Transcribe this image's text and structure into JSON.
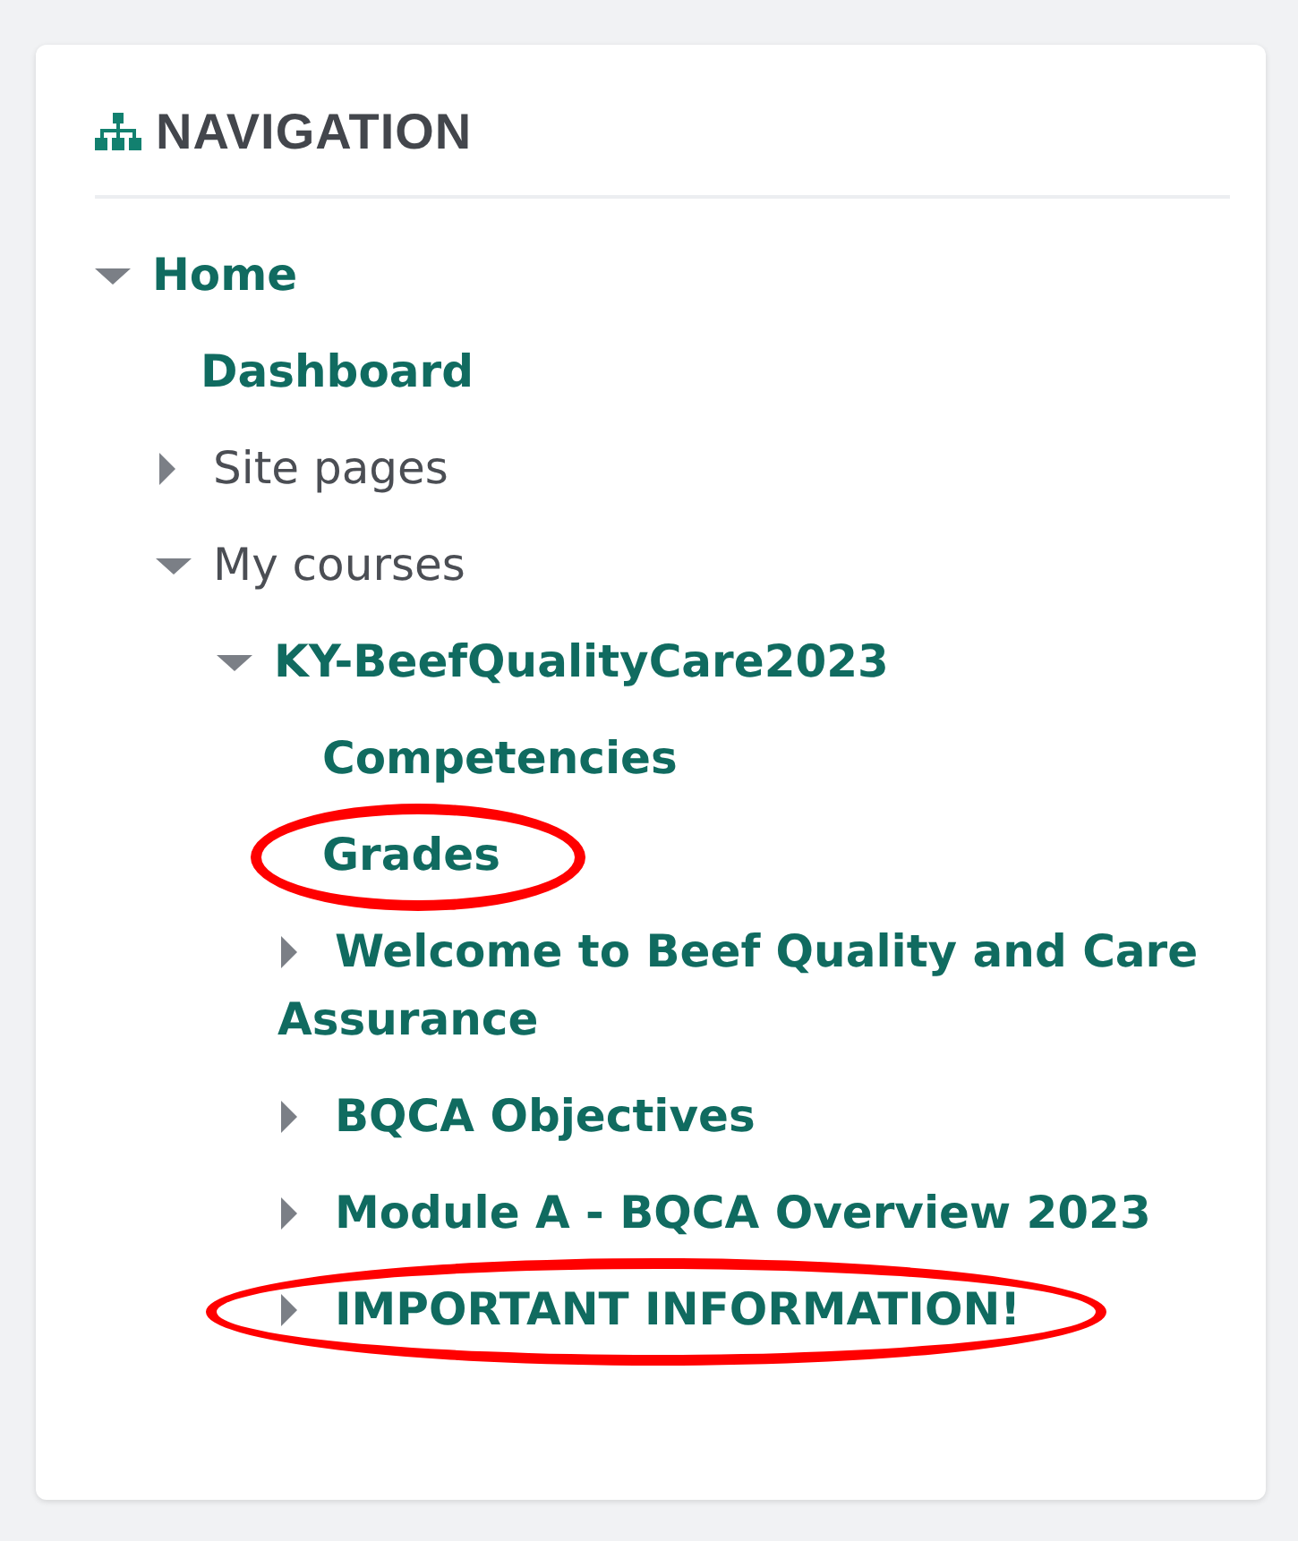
{
  "block": {
    "title": "NAVIGATION"
  },
  "tree": [
    {
      "label": "Home",
      "kind": "link",
      "expanded": true,
      "highlighted": false,
      "children": [
        {
          "label": "Dashboard",
          "kind": "link",
          "highlighted": false
        },
        {
          "label": "Site pages",
          "kind": "plain",
          "expanded": false,
          "highlighted": false
        },
        {
          "label": "My courses",
          "kind": "plain",
          "expanded": true,
          "highlighted": false,
          "children": [
            {
              "label": "KY-BeefQualityCare2023",
              "kind": "link",
              "expanded": true,
              "highlighted": false,
              "children": [
                {
                  "label": "Competencies",
                  "kind": "link",
                  "highlighted": false
                },
                {
                  "label": "Grades",
                  "kind": "link",
                  "highlighted": true
                },
                {
                  "label": "Welcome to Beef Quality and Care Assurance",
                  "kind": "link",
                  "expanded": false,
                  "highlighted": false
                },
                {
                  "label": "BQCA Objectives",
                  "kind": "link",
                  "expanded": false,
                  "highlighted": false
                },
                {
                  "label": "Module A - BQCA Overview 2023",
                  "kind": "link",
                  "expanded": false,
                  "highlighted": false
                },
                {
                  "label": "IMPORTANT INFORMATION!",
                  "kind": "link",
                  "expanded": false,
                  "highlighted": true
                }
              ]
            }
          ]
        }
      ]
    }
  ]
}
